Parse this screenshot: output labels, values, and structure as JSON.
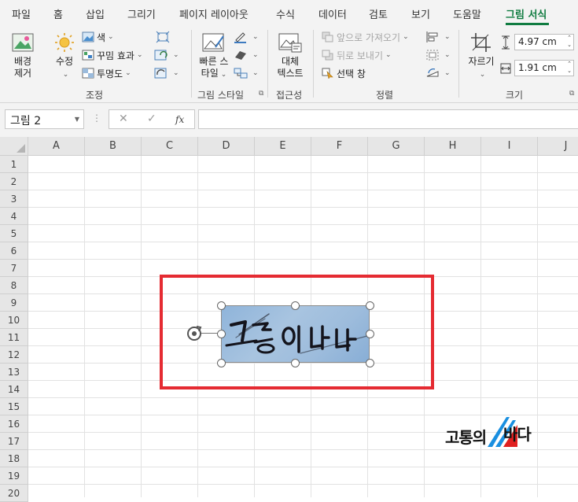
{
  "tabs": [
    {
      "label": "파일"
    },
    {
      "label": "홈"
    },
    {
      "label": "삽입"
    },
    {
      "label": "그리기"
    },
    {
      "label": "페이지 레이아웃"
    },
    {
      "label": "수식"
    },
    {
      "label": "데이터"
    },
    {
      "label": "검토"
    },
    {
      "label": "보기"
    },
    {
      "label": "도움말"
    },
    {
      "label": "그림 서식",
      "active": true
    }
  ],
  "ribbon": {
    "remove_bg_line1": "배경",
    "remove_bg_line2": "제거",
    "corrections": "수정",
    "color": "색",
    "artistic_effects": "꾸밈 효과",
    "transparency": "투명도",
    "group_adjust": "조정",
    "quick_styles_line1": "빠른 스",
    "quick_styles_line2": "타일",
    "group_picture_styles": "그림 스타일",
    "alt_text_line1": "대체",
    "alt_text_line2": "텍스트",
    "group_accessibility": "접근성",
    "bring_forward": "앞으로 가져오기",
    "send_backward": "뒤로 보내기",
    "selection_pane": "선택 창",
    "group_arrange": "정렬",
    "crop": "자르기",
    "height_value": "4.97 cm",
    "width_value": "1.91 cm",
    "group_size": "크기"
  },
  "formula_bar": {
    "name_box": "그림 2",
    "fx_label": "fx"
  },
  "grid": {
    "columns": [
      "A",
      "B",
      "C",
      "D",
      "E",
      "F",
      "G",
      "H",
      "I",
      "J"
    ],
    "rows": [
      "1",
      "2",
      "3",
      "4",
      "5",
      "6",
      "7",
      "8",
      "9",
      "10",
      "11",
      "12",
      "13",
      "14",
      "15",
      "16",
      "17",
      "18",
      "19",
      "20"
    ]
  },
  "logo": {
    "text_1": "고통의",
    "text_2": "바다"
  },
  "colors": {
    "accent": "#107c41",
    "highlight": "#e52b32",
    "logo_blue": "#1a8fe0",
    "logo_red": "#e02020"
  }
}
